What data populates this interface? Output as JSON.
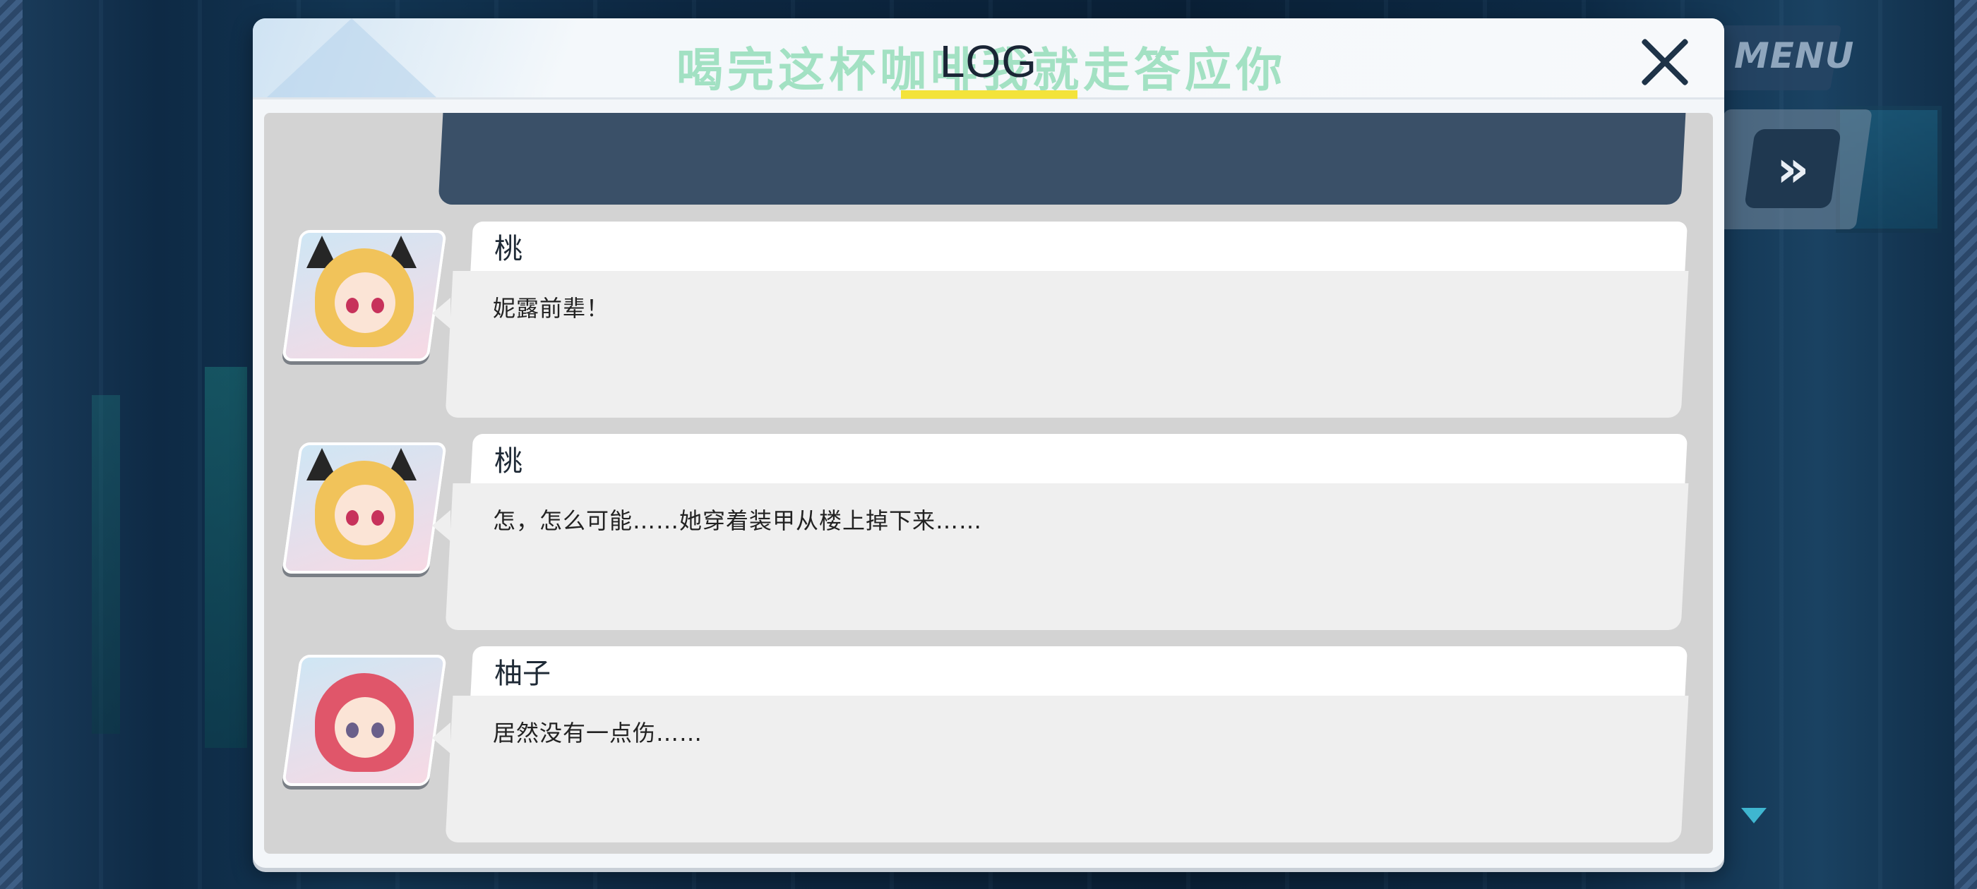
{
  "header": {
    "title": "LOG",
    "watermark": "喝完这杯咖啡我就走答应你"
  },
  "menu": {
    "label": "MENU"
  },
  "fast_forward": {
    "glyph": "»"
  },
  "log_entries": [
    {
      "speaker": "桃",
      "text": "妮露前辈！"
    },
    {
      "speaker": "桃",
      "text": "怎，怎么可能……她穿着装甲从楼上掉下来……"
    },
    {
      "speaker": "柚子",
      "text": "居然没有一点伤……"
    }
  ],
  "colors": {
    "accent_underline": "#f3e33a",
    "top_bar": "#3a5068",
    "panel": "#f3f6f9"
  }
}
